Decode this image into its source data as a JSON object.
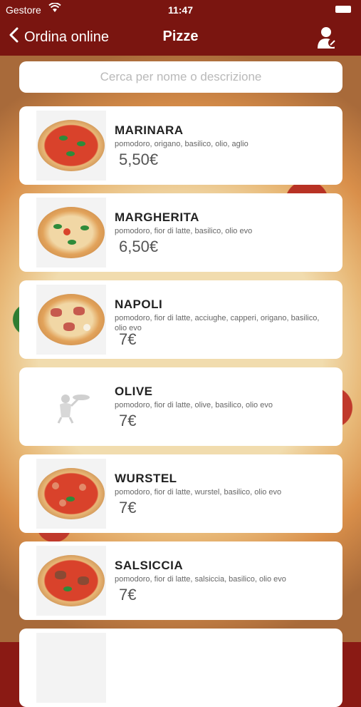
{
  "status_bar": {
    "carrier": "Gestore",
    "time": "11:47"
  },
  "nav": {
    "back_label": "Ordina online",
    "title": "Pizze"
  },
  "search": {
    "placeholder": "Cerca per nome o descrizione"
  },
  "items": [
    {
      "name": "MARINARA",
      "description": "pomodoro, origano, basilico, olio, aglio",
      "price": "5,50€"
    },
    {
      "name": "MARGHERITA",
      "description": "pomodoro, fior di latte, basilico, olio evo",
      "price": "6,50€"
    },
    {
      "name": "NAPOLI",
      "description": "pomodoro, fior di latte, acciughe, capperi, origano, basilico, olio evo",
      "price": "7€"
    },
    {
      "name": "OLIVE",
      "description": "pomodoro, fior di latte, olive, basilico, olio evo",
      "price": "7€"
    },
    {
      "name": "WURSTEL",
      "description": "pomodoro, fior di latte, wurstel, basilico, olio evo",
      "price": "7€"
    },
    {
      "name": "SALSICCIA",
      "description": "pomodoro, fior di latte, salsiccia, basilico, olio evo",
      "price": "7€"
    }
  ],
  "icons": {
    "back": "chevron-left-icon",
    "account": "user-profile-icon",
    "placeholder": "pizza-chef-placeholder-icon"
  },
  "colors": {
    "nav_bar": "#7a1510",
    "card": "#ffffff"
  }
}
